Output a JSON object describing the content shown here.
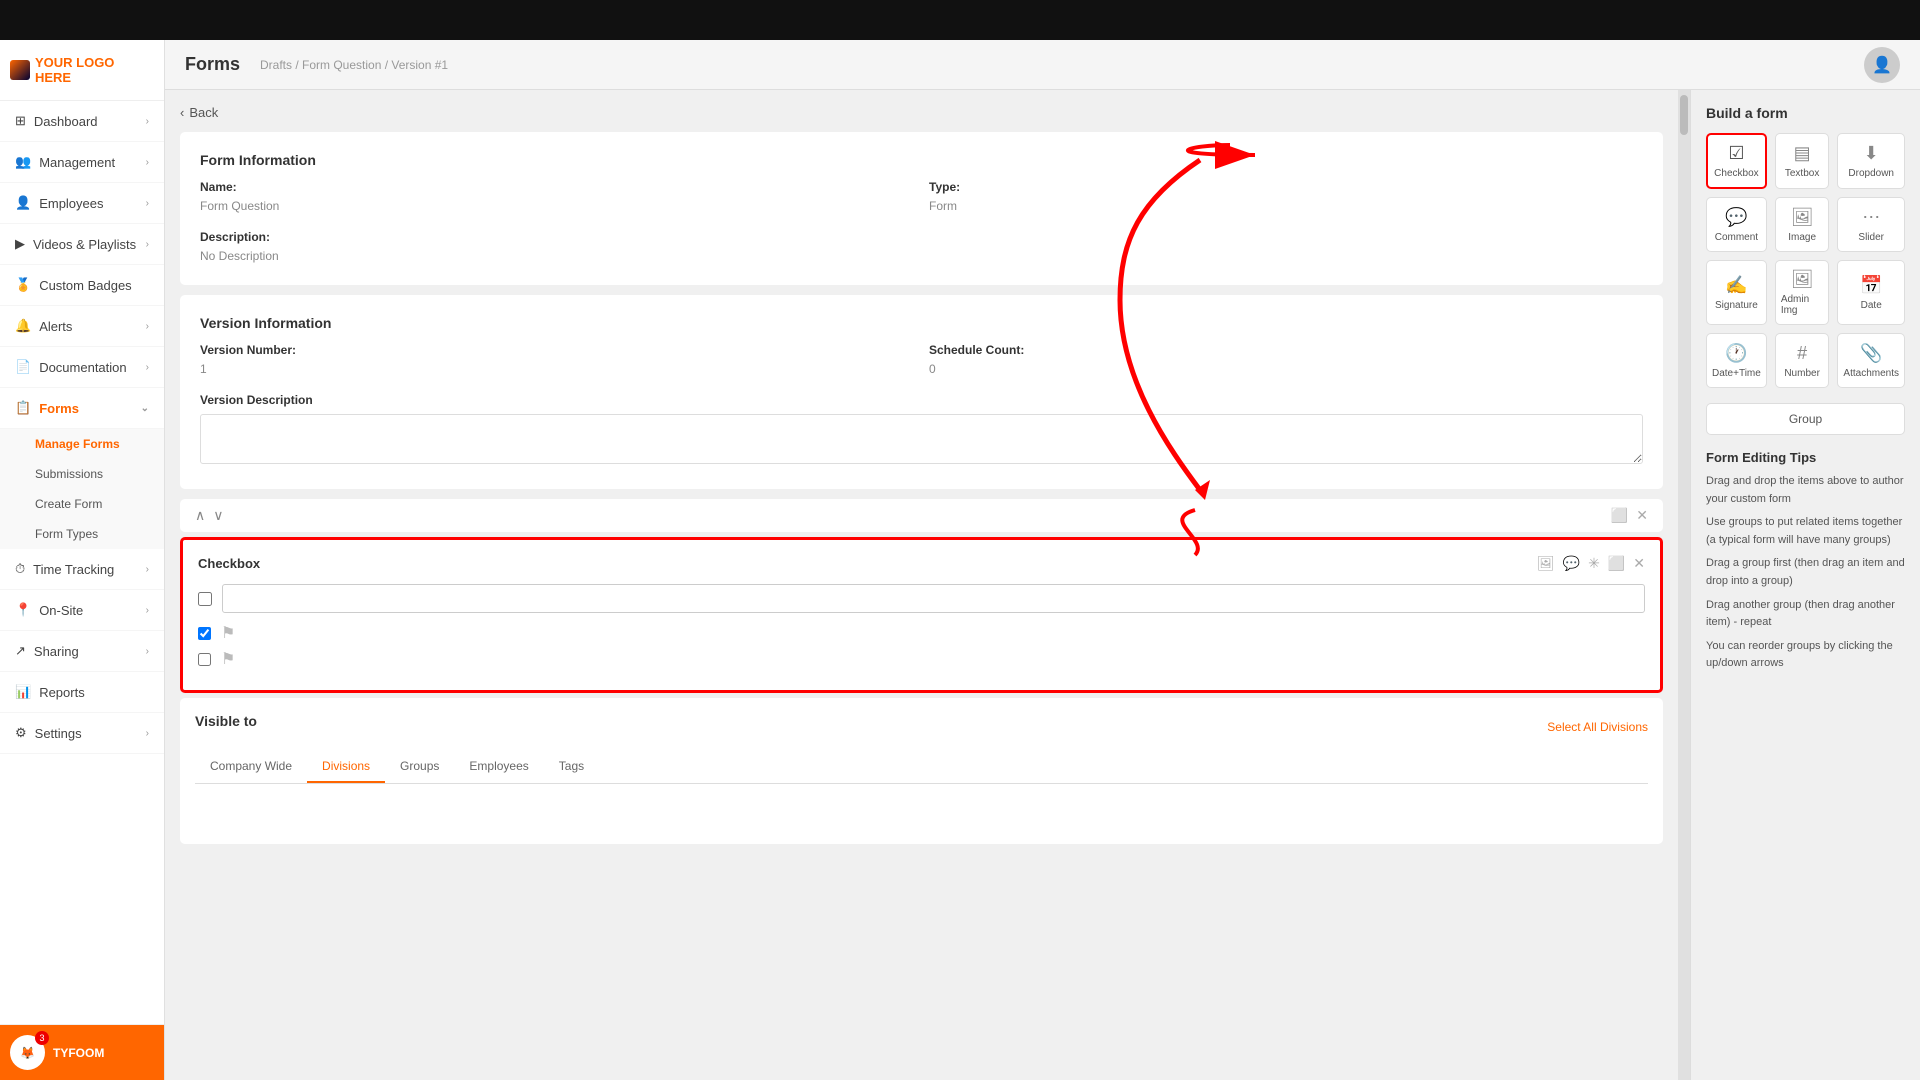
{
  "topBar": {},
  "logo": {
    "text": "YOUR LOGO HERE"
  },
  "sidebar": {
    "items": [
      {
        "id": "dashboard",
        "label": "Dashboard",
        "icon": "⊞",
        "hasChevron": true,
        "active": false
      },
      {
        "id": "management",
        "label": "Management",
        "icon": "👥",
        "hasChevron": true,
        "active": false
      },
      {
        "id": "employees",
        "label": "Employees",
        "icon": "👤",
        "hasChevron": true,
        "active": false
      },
      {
        "id": "videos",
        "label": "Videos & Playlists",
        "icon": "▶",
        "hasChevron": true,
        "active": false
      },
      {
        "id": "custom-badges",
        "label": "Custom Badges",
        "icon": "🏅",
        "hasChevron": false,
        "active": false
      },
      {
        "id": "alerts",
        "label": "Alerts",
        "icon": "🔔",
        "hasChevron": true,
        "active": false
      },
      {
        "id": "documentation",
        "label": "Documentation",
        "icon": "📄",
        "hasChevron": true,
        "active": false
      },
      {
        "id": "forms",
        "label": "Forms",
        "icon": "📋",
        "hasChevron": true,
        "active": true
      },
      {
        "id": "time-tracking",
        "label": "Time Tracking",
        "icon": "⏱",
        "hasChevron": true,
        "active": false
      },
      {
        "id": "on-site",
        "label": "On-Site",
        "icon": "📍",
        "hasChevron": true,
        "active": false
      },
      {
        "id": "sharing",
        "label": "Sharing",
        "icon": "↗",
        "hasChevron": true,
        "active": false
      },
      {
        "id": "reports",
        "label": "Reports",
        "icon": "📊",
        "hasChevron": false,
        "active": false
      },
      {
        "id": "settings",
        "label": "Settings",
        "icon": "⚙",
        "hasChevron": true,
        "active": false
      }
    ],
    "subNav": [
      {
        "id": "manage-forms",
        "label": "Manage Forms",
        "active": true
      },
      {
        "id": "submissions",
        "label": "Submissions",
        "active": false
      },
      {
        "id": "create-form",
        "label": "Create Form",
        "active": false
      },
      {
        "id": "form-types",
        "label": "Form Types",
        "active": false
      }
    ]
  },
  "user": {
    "name": "TYFOOM",
    "badgeCount": "3"
  },
  "header": {
    "title": "Forms",
    "breadcrumb": "Drafts / Form Question / Version #1"
  },
  "backButton": "Back",
  "formInfo": {
    "title": "Form Information",
    "nameLabel": "Name:",
    "nameValue": "Form Question",
    "typeLabel": "Type:",
    "typeValue": "Form",
    "descLabel": "Description:",
    "descValue": "No Description"
  },
  "versionInfo": {
    "title": "Version Information",
    "numberLabel": "Version Number:",
    "numberValue": "1",
    "scheduleLabel": "Schedule Count:",
    "scheduleValue": "0",
    "descLabel": "Version Description"
  },
  "checkboxCard": {
    "title": "Checkbox",
    "inputPlaceholder": ""
  },
  "visibleTo": {
    "title": "Visible to",
    "tabs": [
      {
        "id": "company-wide",
        "label": "Company Wide",
        "active": false
      },
      {
        "id": "divisions",
        "label": "Divisions",
        "active": true
      },
      {
        "id": "groups",
        "label": "Groups",
        "active": false
      },
      {
        "id": "employees",
        "label": "Employees",
        "active": false
      },
      {
        "id": "tags",
        "label": "Tags",
        "active": false
      }
    ],
    "selectAllLabel": "Select All Divisions"
  },
  "buildForm": {
    "title": "Build a form",
    "tools": [
      {
        "id": "checkbox",
        "label": "Checkbox",
        "icon": "☑",
        "highlighted": true
      },
      {
        "id": "textbox",
        "label": "Textbox",
        "icon": "▤"
      },
      {
        "id": "dropdown",
        "label": "Dropdown",
        "icon": "⬇"
      },
      {
        "id": "comment",
        "label": "Comment",
        "icon": "💬"
      },
      {
        "id": "image",
        "label": "Image",
        "icon": "🖼"
      },
      {
        "id": "slider",
        "label": "Slider",
        "icon": "⋯"
      },
      {
        "id": "signature",
        "label": "Signature",
        "icon": "✍"
      },
      {
        "id": "admin-img",
        "label": "Admin Img",
        "icon": "🖼"
      },
      {
        "id": "date",
        "label": "Date",
        "icon": "📅"
      },
      {
        "id": "date-time",
        "label": "Date+Time",
        "icon": "🕐"
      },
      {
        "id": "number",
        "label": "Number",
        "icon": "#"
      },
      {
        "id": "attachments",
        "label": "Attachments",
        "icon": "📎"
      }
    ],
    "groupLabel": "Group"
  },
  "formEditingTips": {
    "title": "Form Editing Tips",
    "tips": [
      "Drag and drop the items above to author your custom form",
      "Use groups to put related items together (a typical form will have many groups)",
      "Drag a group first (then drag an item and drop into a group)",
      "Drag another group (then drag another item) - repeat",
      "You can reorder groups by clicking the up/down arrows"
    ]
  }
}
